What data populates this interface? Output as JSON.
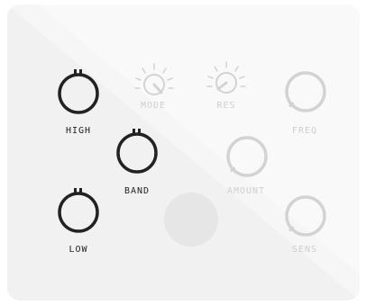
{
  "panel": {
    "colors": {
      "light_bg": "#f9f9f9",
      "shaded_bg": "#f1f1f1",
      "dark_ink": "#222222",
      "faded_ink": "#cfcfcf",
      "pad": "#e6e6e6"
    }
  },
  "knobs": {
    "high": {
      "label": "HIGH"
    },
    "band": {
      "label": "BAND"
    },
    "low": {
      "label": "LOW"
    },
    "mode": {
      "label": "MODE"
    },
    "res": {
      "label": "RES"
    },
    "freq": {
      "label": "FREQ"
    },
    "amount": {
      "label": "AMOUNT"
    },
    "sens": {
      "label": "SENS"
    }
  }
}
